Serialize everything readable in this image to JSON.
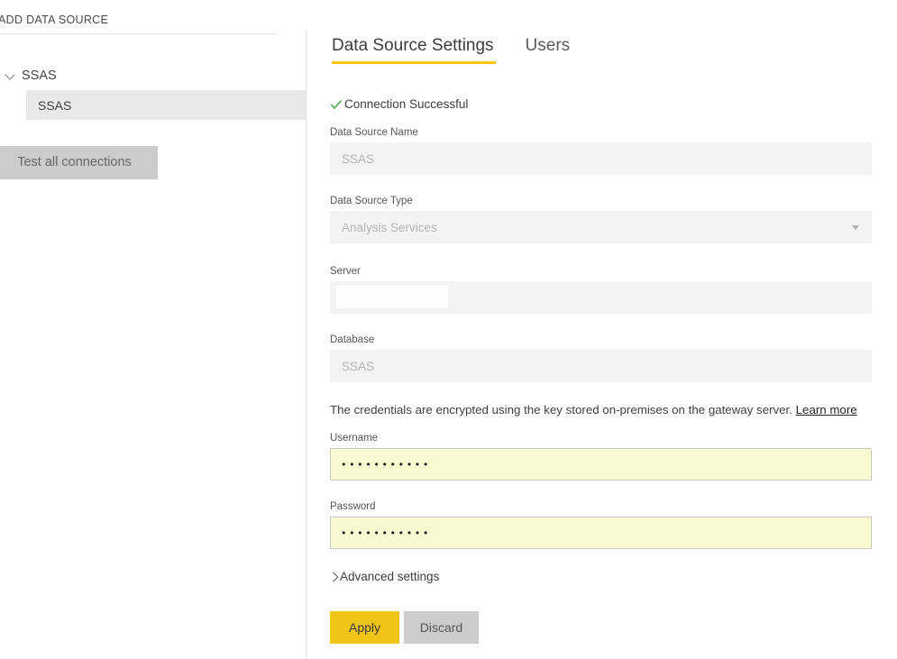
{
  "sidebar": {
    "title": "ADD DATA SOURCE",
    "group": {
      "label": "SSAS",
      "icon": "chevron-down-icon",
      "expanded": true
    },
    "data_sources": [
      {
        "label": "SSAS",
        "selected": true
      }
    ],
    "test_all_connections_label": "Test all connections"
  },
  "main": {
    "tabs": [
      {
        "label": "Data Source Settings",
        "active": true
      },
      {
        "label": "Users",
        "active": false
      }
    ],
    "connection_status": {
      "label": "Connection Successful",
      "icon": "check-icon",
      "color": "#3ca03c"
    },
    "fields": {
      "data_source_name": {
        "label": "Data Source Name",
        "value": "SSAS",
        "readonly": true
      },
      "data_source_type": {
        "label": "Data Source Type",
        "value": "Analysis Services",
        "caret_icon": "chevron-down-icon",
        "readonly": true
      },
      "server": {
        "label": "Server",
        "value": "",
        "redacted": true
      },
      "database": {
        "label": "Database",
        "value": "SSAS",
        "readonly": true
      },
      "username": {
        "label": "Username",
        "value": "•••••••••••"
      },
      "password": {
        "label": "Password",
        "value": "•••••••••••"
      }
    },
    "credentials_note": {
      "text": "The credentials are encrypted using the key stored on-premises on the gateway server.",
      "link_label": "Learn more"
    },
    "advanced_settings": {
      "label": "Advanced settings",
      "icon": "chevron-right-icon",
      "expanded": false
    },
    "buttons": {
      "apply": {
        "label": "Apply",
        "color": "#eec517"
      },
      "discard": {
        "label": "Discard",
        "color": "#cccccc"
      }
    }
  }
}
